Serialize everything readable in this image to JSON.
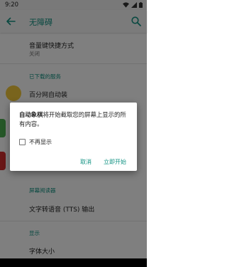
{
  "status_bar": {
    "time": "9:20",
    "icons": [
      "wifi-icon",
      "signal-icon",
      "battery-icon"
    ]
  },
  "app_bar": {
    "title": "无障碍",
    "back_icon": "arrow-back-icon",
    "search_icon": "search-icon"
  },
  "list": {
    "shortcut": {
      "title": "音量键快捷方式",
      "subtitle": "关闭"
    },
    "downloaded_header": "已下载的服务",
    "service": {
      "title": "百分网自动装"
    },
    "screen_reader_header": "屏幕阅读器",
    "tts": {
      "title": "文字转语音 (TTS) 输出"
    },
    "display_header": "显示",
    "font_size": {
      "title": "字体大小"
    }
  },
  "dialog": {
    "app_name": "自动象棋",
    "message_rest": "将开始截取您的屏幕上显示的所有内容。",
    "checkbox_label": "不再显示",
    "checkbox_checked": false,
    "cancel_label": "取消",
    "start_label": "立即开始"
  },
  "colors": {
    "accent": "#129383",
    "scrim": "rgba(0,0,0,0.5)"
  }
}
